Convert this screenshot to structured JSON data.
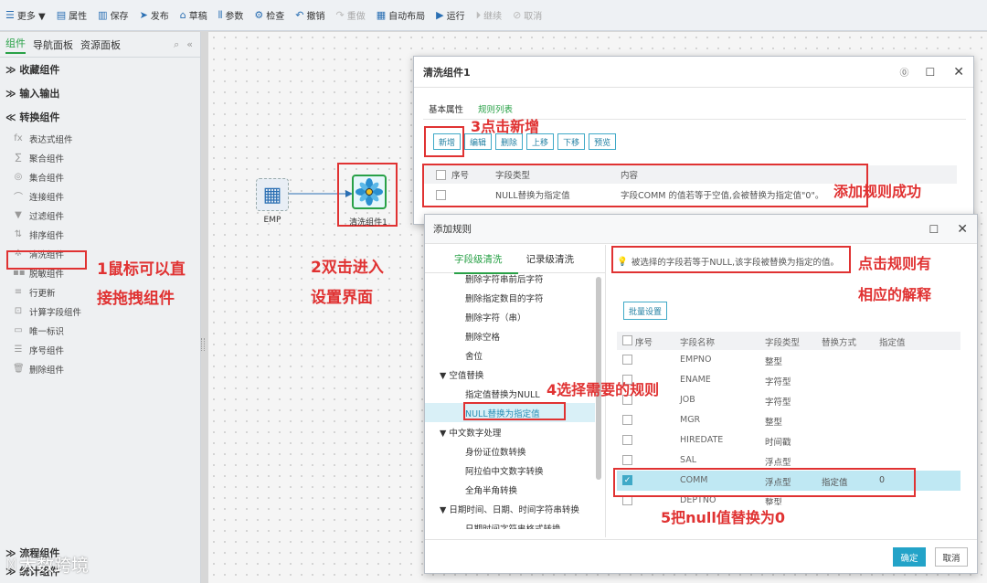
{
  "toolbar": {
    "items": [
      {
        "icon": "☰",
        "label": "更多 ▼",
        "disabled": false
      },
      {
        "icon": "▤",
        "label": "属性",
        "disabled": false
      },
      {
        "icon": "▥",
        "label": "保存",
        "disabled": false
      },
      {
        "icon": "➤",
        "label": "发布",
        "disabled": false
      },
      {
        "icon": "⌂",
        "label": "草稿",
        "disabled": false
      },
      {
        "icon": "⫴",
        "label": "参数",
        "disabled": false
      },
      {
        "icon": "⚙",
        "label": "检查",
        "disabled": false
      },
      {
        "icon": "↶",
        "label": "撤销",
        "disabled": false
      },
      {
        "icon": "↷",
        "label": "重做",
        "disabled": true
      },
      {
        "icon": "▦",
        "label": "自动布局",
        "disabled": false
      },
      {
        "icon": "▶",
        "label": "运行",
        "disabled": false
      },
      {
        "icon": "⏵",
        "label": "继续",
        "disabled": true
      },
      {
        "icon": "⊘",
        "label": "取消",
        "disabled": true
      }
    ]
  },
  "sidebar": {
    "tabs": [
      "组件",
      "导航面板",
      "资源面板"
    ],
    "sections": {
      "favorites": "≫ 收藏组件",
      "io": "≫ 输入输出",
      "transform": "≪ 转换组件",
      "flow": "≫ 流程组件",
      "stats": "≫ 统计组件"
    },
    "items": [
      {
        "icon": "fx",
        "label": "表达式组件"
      },
      {
        "icon": "∑",
        "label": "聚合组件"
      },
      {
        "icon": "◎",
        "label": "集合组件"
      },
      {
        "icon": "⌒",
        "label": "连接组件"
      },
      {
        "icon": "▼",
        "label": "过滤组件"
      },
      {
        "icon": "⇅",
        "label": "排序组件"
      },
      {
        "icon": "✲",
        "label": "清洗组件"
      },
      {
        "icon": "▪▪",
        "label": "脱敏组件"
      },
      {
        "icon": "≡",
        "label": "行更新"
      },
      {
        "icon": "⊡",
        "label": "计算字段组件"
      },
      {
        "icon": "▭",
        "label": "唯一标识"
      },
      {
        "icon": "☰",
        "label": "序号组件"
      },
      {
        "icon": "🗑",
        "label": "删除组件"
      }
    ]
  },
  "canvas": {
    "node_emp": "EMP",
    "node_clean": "清洗组件1",
    "anno1_line1": "1鼠标可以直",
    "anno1_line2": "接拖拽组件",
    "anno2_line1": "2双击进入",
    "anno2_line2": "设置界面"
  },
  "dialog1": {
    "title": "清洗组件1",
    "tabs": [
      "基本属性",
      "规则列表"
    ],
    "buttons": [
      "新增",
      "编辑",
      "删除",
      "上移",
      "下移",
      "预览"
    ],
    "columns": [
      "序号",
      "字段类型",
      "内容"
    ],
    "row": {
      "type": "NULL替换为指定值",
      "content": "字段COMM 的值若等于空值,会被替换为指定值\"0\"。"
    },
    "anno3": "3点击新增",
    "anno_success": "添加规则成功"
  },
  "dialog2": {
    "title": "添加规则",
    "tabs": [
      "字段级清洗",
      "记录级清洗"
    ],
    "tree": [
      {
        "label": "删除字符串前后字符",
        "level": 2
      },
      {
        "label": "删除指定数目的字符",
        "level": 2
      },
      {
        "label": "删除字符（串）",
        "level": 2
      },
      {
        "label": "删除空格",
        "level": 2
      },
      {
        "label": "舍位",
        "level": 2
      },
      {
        "label": "▼  空值替换",
        "level": 1
      },
      {
        "label": "指定值替换为NULL",
        "level": 2
      },
      {
        "label": "NULL替换为指定值",
        "level": 2,
        "selected": true
      },
      {
        "label": "▼  中文数字处理",
        "level": 1
      },
      {
        "label": "身份证位数转换",
        "level": 2
      },
      {
        "label": "阿拉伯中文数字转换",
        "level": 2
      },
      {
        "label": "全角半角转换",
        "level": 2
      },
      {
        "label": "▼  日期时间、日期、时间字符串转换",
        "level": 1
      },
      {
        "label": "日期时间字符串格式转换",
        "level": 2
      }
    ],
    "hint": "被选择的字段若等于NULL,该字段被替换为指定的值。",
    "batch_button": "批量设置",
    "columns": [
      "序号",
      "字段名称",
      "字段类型",
      "替换方式",
      "指定值"
    ],
    "rows": [
      {
        "name": "EMPNO",
        "type": "整型",
        "mode": "",
        "value": "",
        "checked": false
      },
      {
        "name": "ENAME",
        "type": "字符型",
        "mode": "",
        "value": "",
        "checked": false
      },
      {
        "name": "JOB",
        "type": "字符型",
        "mode": "",
        "value": "",
        "checked": false
      },
      {
        "name": "MGR",
        "type": "整型",
        "mode": "",
        "value": "",
        "checked": false
      },
      {
        "name": "HIREDATE",
        "type": "时间戳",
        "mode": "",
        "value": "",
        "checked": false
      },
      {
        "name": "SAL",
        "type": "浮点型",
        "mode": "",
        "value": "",
        "checked": false
      },
      {
        "name": "COMM",
        "type": "浮点型",
        "mode": "指定值",
        "value": "0",
        "checked": true
      },
      {
        "name": "DEPTNO",
        "type": "整型",
        "mode": "",
        "value": "",
        "checked": false
      }
    ],
    "ok": "确定",
    "cancel": "取消",
    "anno4": "4选择需要的规则",
    "anno5": "5把null值替换为0",
    "anno_explain1": "点击规则有",
    "anno_explain2": "相应的解释"
  },
  "watermark": "大数跨境"
}
